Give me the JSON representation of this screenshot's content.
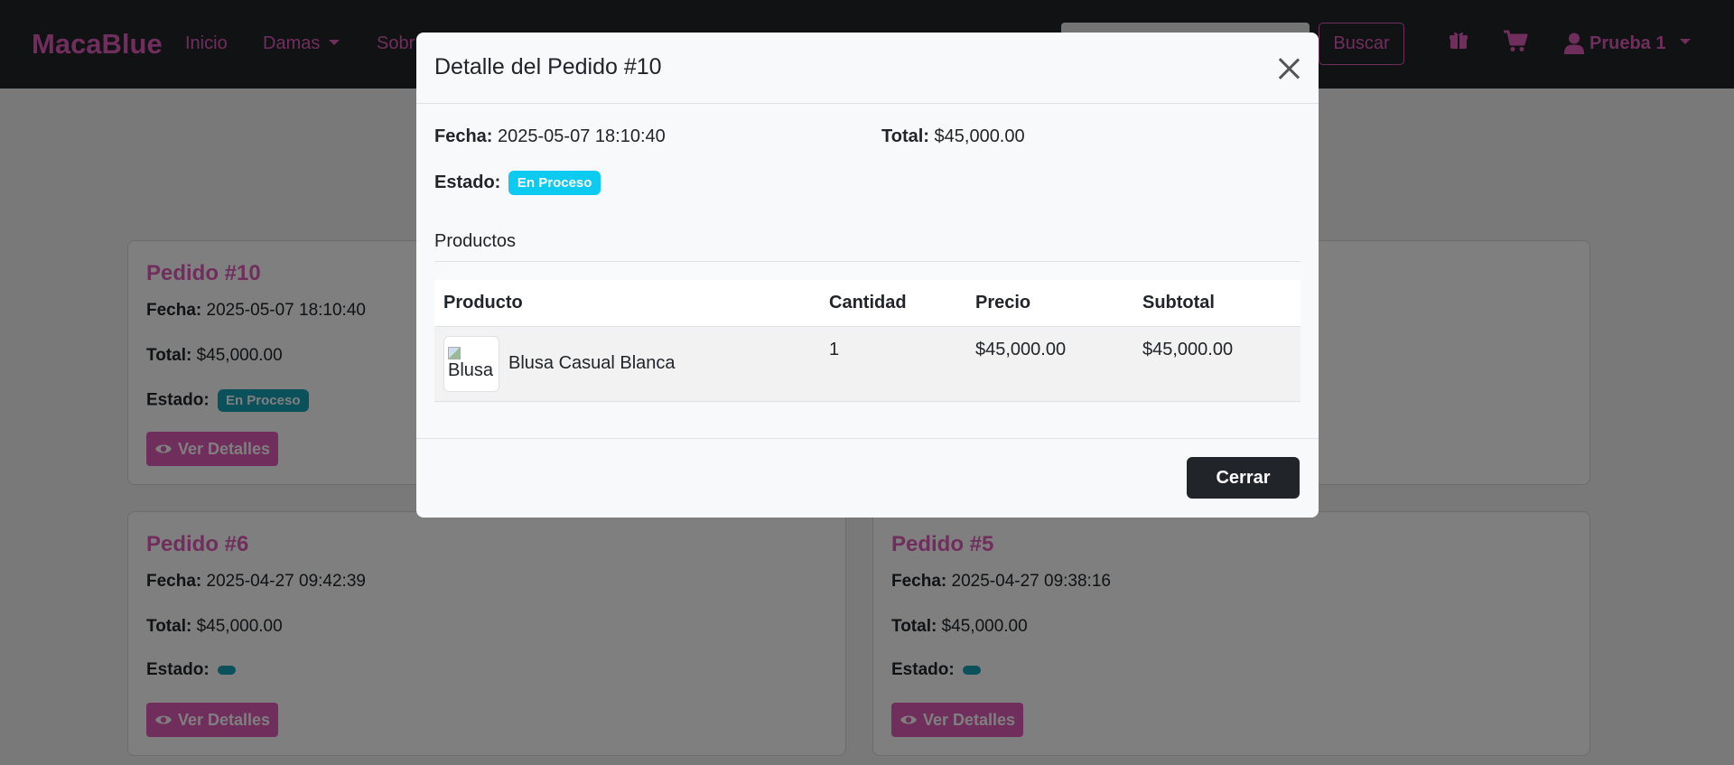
{
  "navbar": {
    "brand": "MacaBlue",
    "links": {
      "inicio": "Inicio",
      "damas": "Damas",
      "sobre": "Sobr"
    },
    "search_button": "Buscar",
    "user_name": "Prueba 1",
    "icons": [
      "gift-icon",
      "cart-icon",
      "user-icon"
    ]
  },
  "labels": {
    "fecha": "Fecha:",
    "total": "Total:",
    "estado": "Estado:",
    "ver_detalles": "Ver Detalles"
  },
  "cards": [
    {
      "title": "Pedido #10",
      "fecha": "2025-05-07 18:10:40",
      "total": "$45,000.00",
      "estado": "En Proceso"
    },
    {
      "title": "Pedido #6",
      "fecha": "2025-04-27 09:42:39",
      "total": "$45,000.00",
      "estado": ""
    },
    {
      "title": "Pedido #5",
      "fecha": "2025-04-27 09:38:16",
      "total": "$45,000.00",
      "estado": ""
    }
  ],
  "modal": {
    "title": "Detalle del Pedido #10",
    "fecha": "2025-05-07 18:10:40",
    "total": "$45,000.00",
    "estado": "En Proceso",
    "section_title": "Productos",
    "table": {
      "headers": [
        "Producto",
        "Cantidad",
        "Precio",
        "Subtotal"
      ],
      "rows": [
        {
          "image_alt": "Blusa",
          "producto": "Blusa Casual Blanca",
          "cantidad": "1",
          "precio": "$45,000.00",
          "subtotal": "$45,000.00"
        }
      ]
    },
    "footer_button": "Cerrar"
  },
  "colors": {
    "brand": "#e05cba",
    "navbar_bg": "#212529",
    "badge_modal": "#0dcaf0",
    "badge_card": "#17a2b8"
  }
}
